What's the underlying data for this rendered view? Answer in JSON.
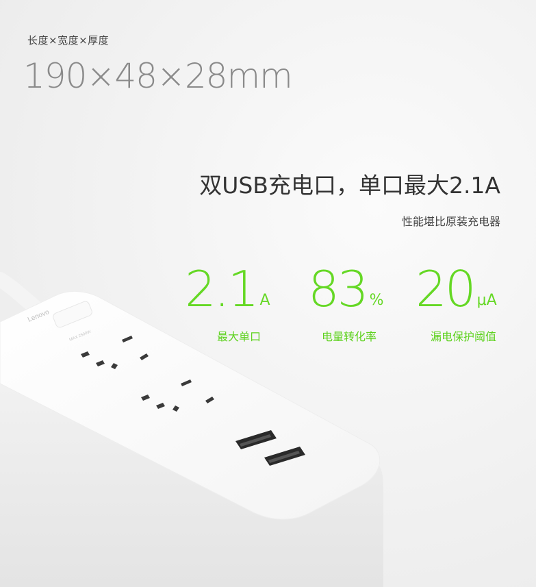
{
  "dimensions": {
    "label": "长度×宽度×厚度",
    "value": "190×48×28mm"
  },
  "headline": "双USB充电口，单口最大2.1A",
  "subheadline": "性能堪比原装充电器",
  "stats": [
    {
      "value": "2.1",
      "unit": "A",
      "caption": "最大单口"
    },
    {
      "value": "83",
      "unit": "%",
      "caption": "电量转化率"
    },
    {
      "value": "20",
      "unit": "μA",
      "caption": "漏电保护阈值"
    }
  ],
  "product": {
    "brand_mark": "Lenovo",
    "rating_mark": "MAX 2500W"
  },
  "colors": {
    "accent_green": "#65d825",
    "text_dark": "#333333",
    "text_gray": "#8a8a8a"
  }
}
